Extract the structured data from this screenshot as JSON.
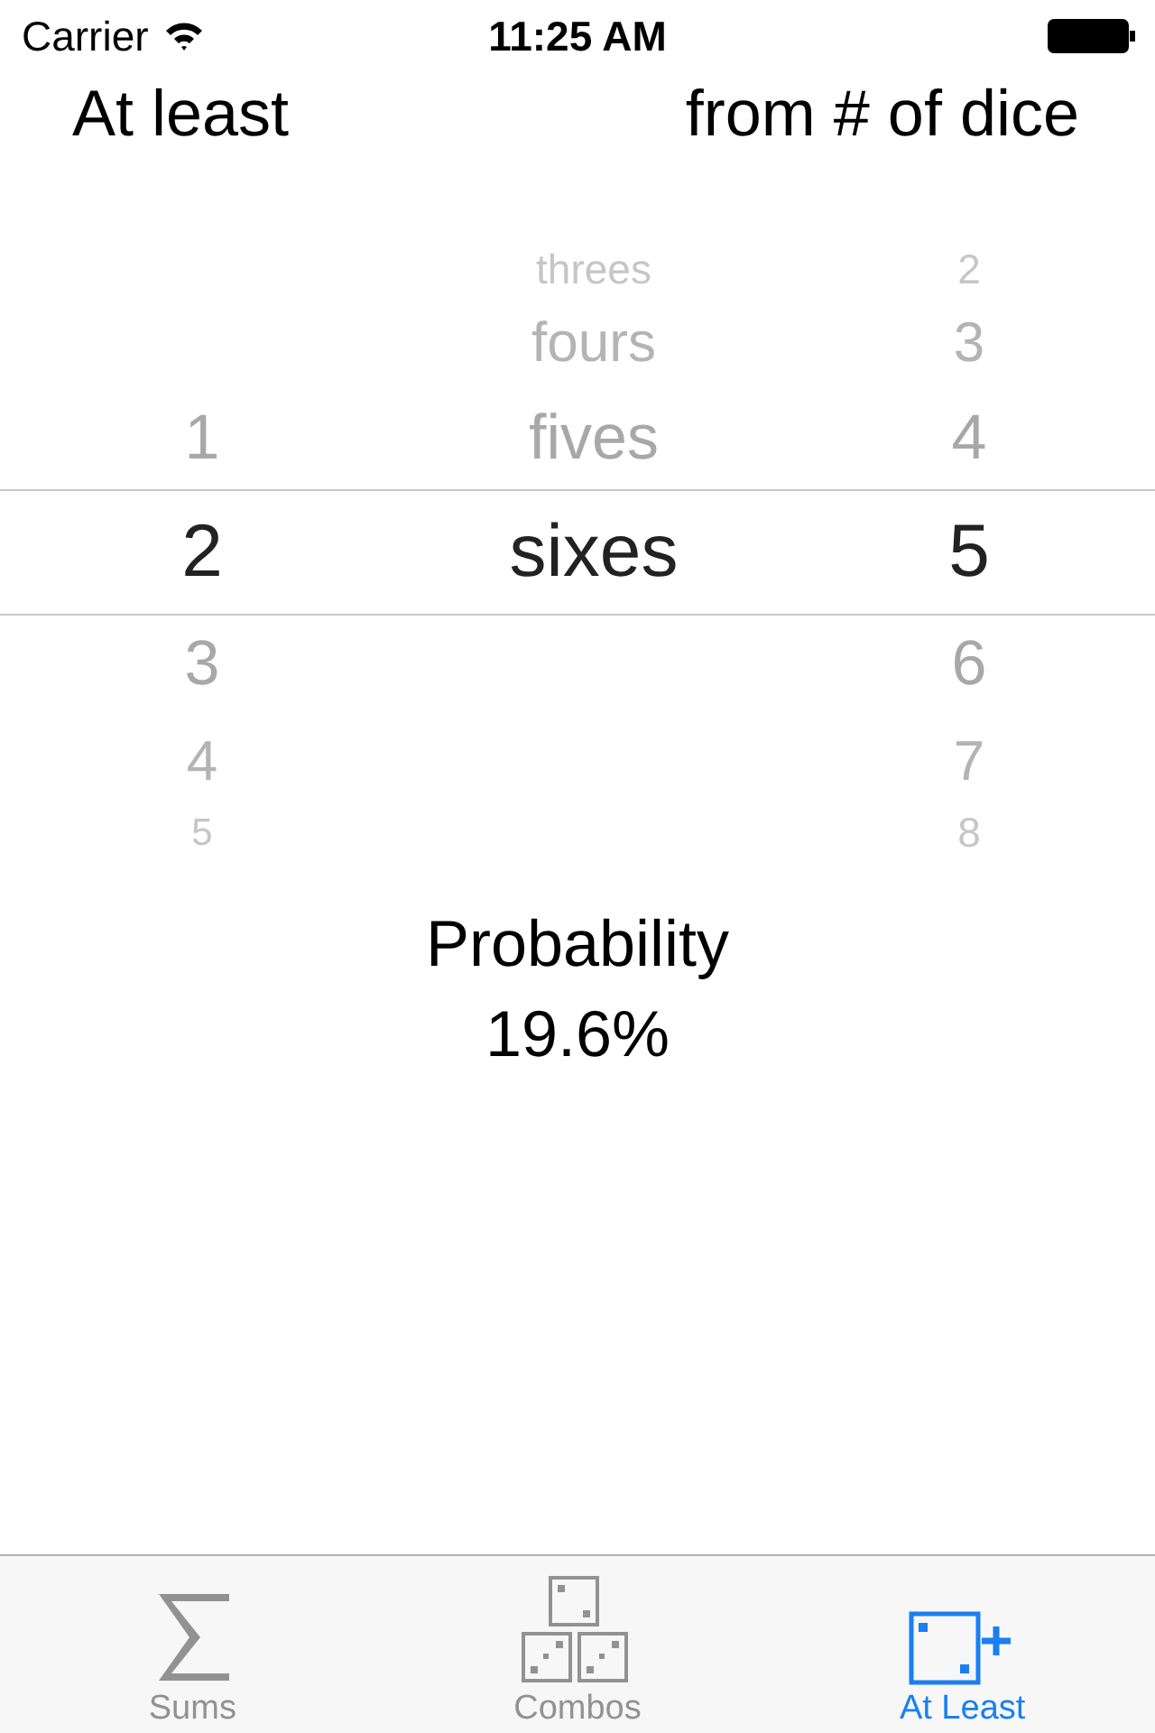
{
  "status_bar": {
    "carrier": "Carrier",
    "time": "11:25 AM"
  },
  "headers": [
    "At least",
    "from # of dice"
  ],
  "picker": {
    "wheels": [
      {
        "items": [
          {
            "label": "1",
            "selected": false
          },
          {
            "label": "2",
            "selected": true
          },
          {
            "label": "3",
            "selected": false
          },
          {
            "label": "4",
            "selected": false
          },
          {
            "label": "5",
            "selected": false
          }
        ]
      },
      {
        "items": [
          {
            "label": "threes",
            "selected": false
          },
          {
            "label": "fours",
            "selected": false
          },
          {
            "label": "fives",
            "selected": false
          },
          {
            "label": "sixes",
            "selected": true
          }
        ]
      },
      {
        "items": [
          {
            "label": "2",
            "selected": false
          },
          {
            "label": "3",
            "selected": false
          },
          {
            "label": "4",
            "selected": false
          },
          {
            "label": "5",
            "selected": true
          },
          {
            "label": "6",
            "selected": false
          },
          {
            "label": "7",
            "selected": false
          },
          {
            "label": "8",
            "selected": false
          }
        ]
      }
    ]
  },
  "result": {
    "label": "Probability",
    "value": "19.6%"
  },
  "tab_bar": [
    {
      "kind": "sigma",
      "label": "Sums",
      "selected": false
    },
    {
      "kind": "dice",
      "label": "Combos",
      "selected": false
    },
    {
      "kind": "die-plus",
      "label": "At Least",
      "selected": true
    }
  ]
}
